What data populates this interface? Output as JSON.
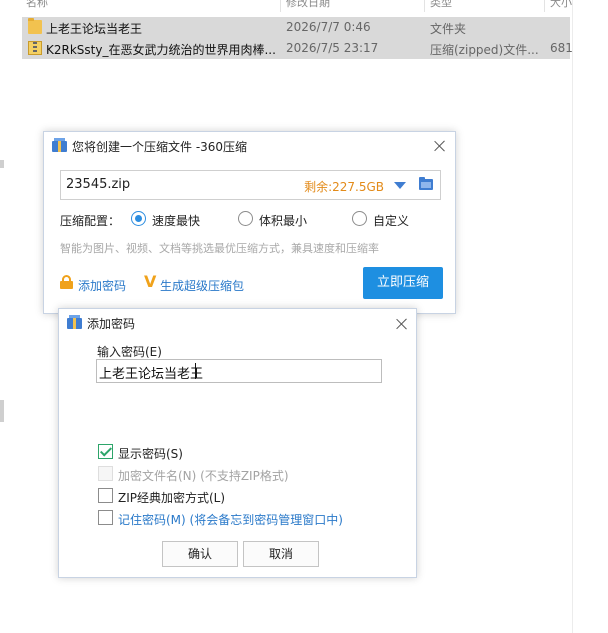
{
  "explorer": {
    "columns": [
      "名称",
      "修改日期",
      "类型",
      "大小"
    ],
    "files": [
      {
        "icon": "folder-icon",
        "name": "上老王论坛当老王",
        "date": "2026/7/7 0:46",
        "type": "文件夹",
        "size": ""
      },
      {
        "icon": "zip-icon",
        "name": "K2RkSsty_在恶女武力统治的世界用肉棒...",
        "date": "2026/7/5 23:17",
        "type": "压缩(zipped)文件...",
        "size": "681"
      }
    ]
  },
  "compress_dialog": {
    "title": "您将创建一个压缩文件 -360压缩",
    "filename": "23545.zip",
    "free_space": "剩余:227.5GB",
    "config_label": "压缩配置：",
    "options": [
      {
        "label": "速度最快",
        "checked": true
      },
      {
        "label": "体积最小",
        "checked": false
      },
      {
        "label": "自定义",
        "checked": false
      }
    ],
    "hint": "智能为图片、视频、文档等挑选最优压缩方式，兼具速度和压缩率",
    "add_password_link": "添加密码",
    "super_pack_link": "生成超级压缩包",
    "compress_button": "立即压缩"
  },
  "password_dialog": {
    "title": "添加密码",
    "input_label": "输入密码(E)",
    "password_value": "上老王论坛当老王",
    "options": [
      {
        "label": "显示密码(S)",
        "checked": true,
        "disabled": false
      },
      {
        "label": "加密文件名(N) (不支持ZIP格式)",
        "checked": false,
        "disabled": true
      },
      {
        "label": "ZIP经典加密方式(L)",
        "checked": false,
        "disabled": false
      },
      {
        "label": "记住密码(M) (将会备忘到密码管理窗口中)",
        "checked": false,
        "disabled": false
      }
    ],
    "ok_button": "确认",
    "cancel_button": "取消"
  }
}
